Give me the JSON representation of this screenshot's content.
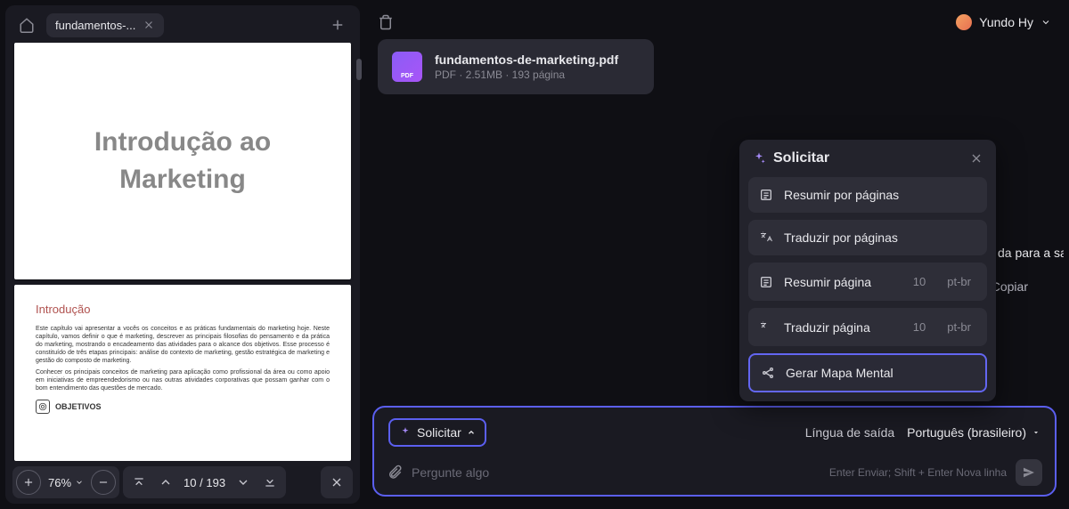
{
  "tab": {
    "title": "fundamentos-..."
  },
  "pdf": {
    "title_page": "Introdução ao Marketing",
    "content_heading": "Introdução",
    "content_p1": "Este capítulo vai apresentar a vocês os conceitos e as práticas fundamentais do marketing hoje. Neste capítulo, vamos definir o que é marketing, descrever as principais filosofias do pensamento e da prática do marketing, mostrando o encadeamento das atividades para o alcance dos objetivos. Esse processo é constituído de três etapas principais: análise do contexto de marketing, gestão estratégica de marketing e gestão do composto de marketing.",
    "content_p2": "Conhecer os principais conceitos de marketing para aplicação como profissional da área ou como apoio em iniciativas de empreendedorismo ou nas outras atividades corporativas que possam ganhar com o bom entendimento das questões de mercado.",
    "objetivos": "OBJETIVOS"
  },
  "toolbar": {
    "zoom": "76%",
    "page_current": "10",
    "page_total": "193"
  },
  "user": {
    "name": "Yundo Hy"
  },
  "file": {
    "name": "fundamentos-de-marketing.pdf",
    "meta": "PDF · 2.51MB · 193 página",
    "icon_label": "PDF"
  },
  "preview": {
    "text": "da para a satisfação das necessidades e desejos do consum",
    "copy": "Copiar"
  },
  "popup": {
    "title": "Solicitar",
    "items": [
      {
        "label": "Resumir por páginas"
      },
      {
        "label": "Traduzir por páginas"
      },
      {
        "label": "Resumir página",
        "page": "10",
        "lang": "pt-br"
      },
      {
        "label": "Traduzir página",
        "page": "10",
        "lang": "pt-br"
      },
      {
        "label": "Gerar Mapa Mental",
        "highlighted": true
      }
    ]
  },
  "input": {
    "solicitar": "Solicitar",
    "lang_label": "Língua de saída",
    "lang_value": "Português (brasileiro)",
    "placeholder": "Pergunte algo",
    "hint": "Enter Enviar; Shift + Enter Nova linha"
  }
}
